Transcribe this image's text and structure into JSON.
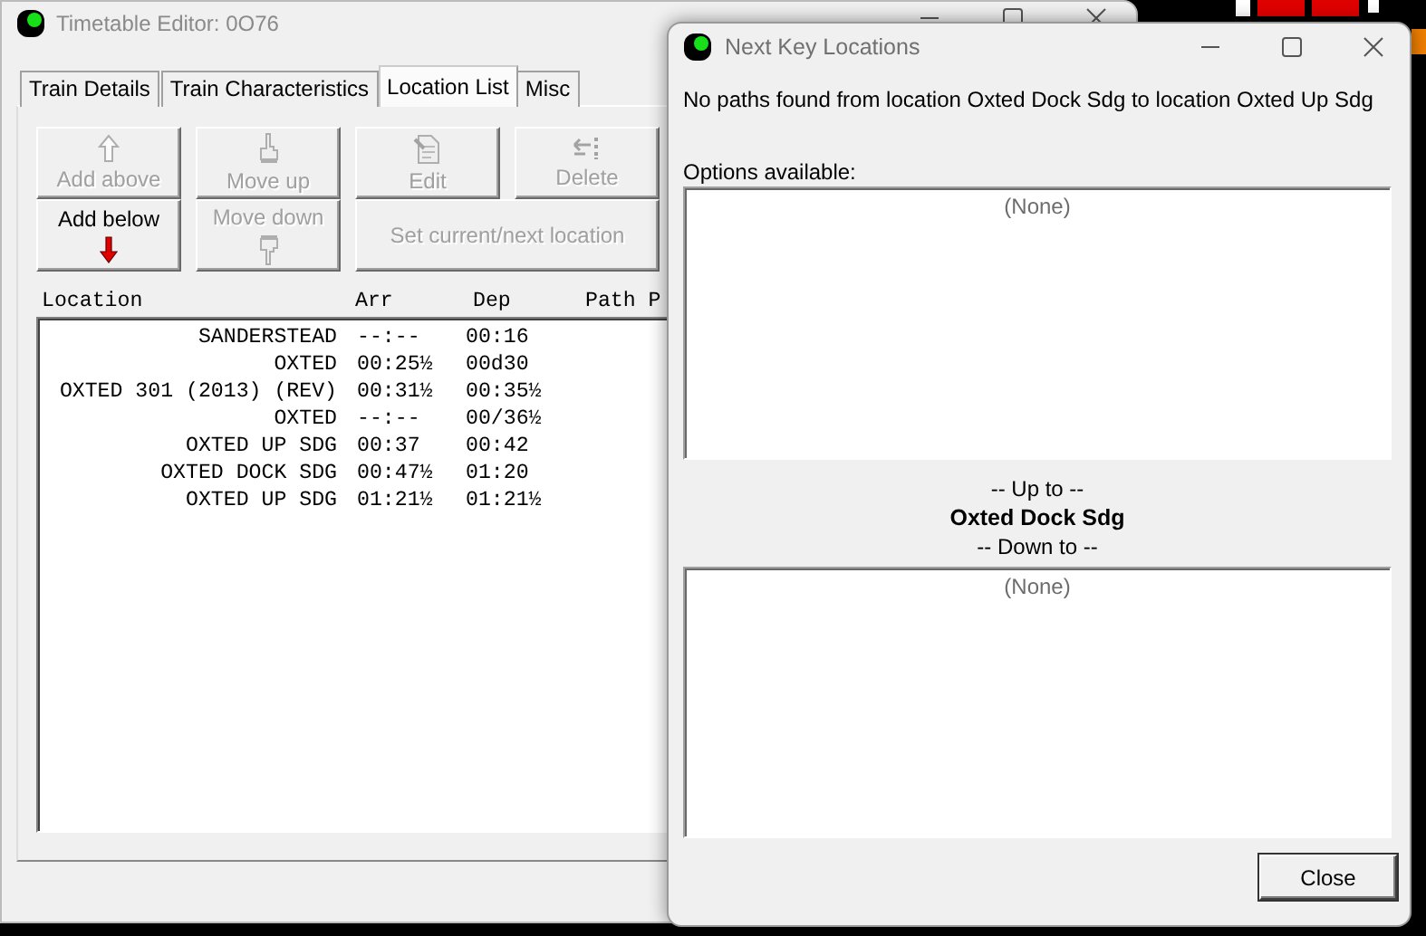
{
  "main_window": {
    "title": "Timetable Editor: 0O76",
    "tabs": [
      {
        "label": "Train Details",
        "selected": false
      },
      {
        "label": "Train Characteristics",
        "selected": false
      },
      {
        "label": "Location List",
        "selected": true
      },
      {
        "label": "Misc",
        "selected": false
      }
    ],
    "buttons": [
      {
        "label": "Add above",
        "kind": "icon-above",
        "disabled": true
      },
      {
        "label": "Move up",
        "kind": "icon-above",
        "disabled": true
      },
      {
        "label": "Edit",
        "kind": "icon-above",
        "disabled": true
      },
      {
        "label": "Delete",
        "kind": "icon-above",
        "disabled": true
      },
      {
        "label": "Add below",
        "kind": "icon-below",
        "disabled": false
      },
      {
        "label": "Move down",
        "kind": "icon-below",
        "disabled": true
      },
      {
        "label": "Set current/next location",
        "kind": "text",
        "disabled": true
      }
    ],
    "location_list": {
      "columns": [
        "Location",
        "Arr",
        "Dep",
        "Path P"
      ],
      "rows": [
        {
          "location": "SANDERSTEAD",
          "arr": "--:--",
          "dep": "00:16"
        },
        {
          "location": "OXTED",
          "arr": "00:25½",
          "dep": "00d30"
        },
        {
          "location": "OXTED 301 (2013) (REV)",
          "arr": "00:31½",
          "dep": "00:35½"
        },
        {
          "location": "OXTED",
          "arr": "--:--",
          "dep": "00/36½"
        },
        {
          "location": "OXTED UP SDG",
          "arr": "00:37",
          "dep": "00:42"
        },
        {
          "location": "OXTED DOCK SDG",
          "arr": "00:47½",
          "dep": "01:20"
        },
        {
          "location": "OXTED UP SDG",
          "arr": "01:21½",
          "dep": "01:21½"
        }
      ]
    }
  },
  "dialog": {
    "title": "Next Key Locations",
    "message": "No paths found from location Oxted Dock Sdg to location Oxted Up Sdg",
    "options_label": "Options available:",
    "up_list": {
      "empty_text": "(None)"
    },
    "up_to_label": "-- Up to --",
    "current_location": "Oxted Dock Sdg",
    "down_to_label": "-- Down to --",
    "down_list": {
      "empty_text": "(None)"
    },
    "close_button": "Close"
  }
}
